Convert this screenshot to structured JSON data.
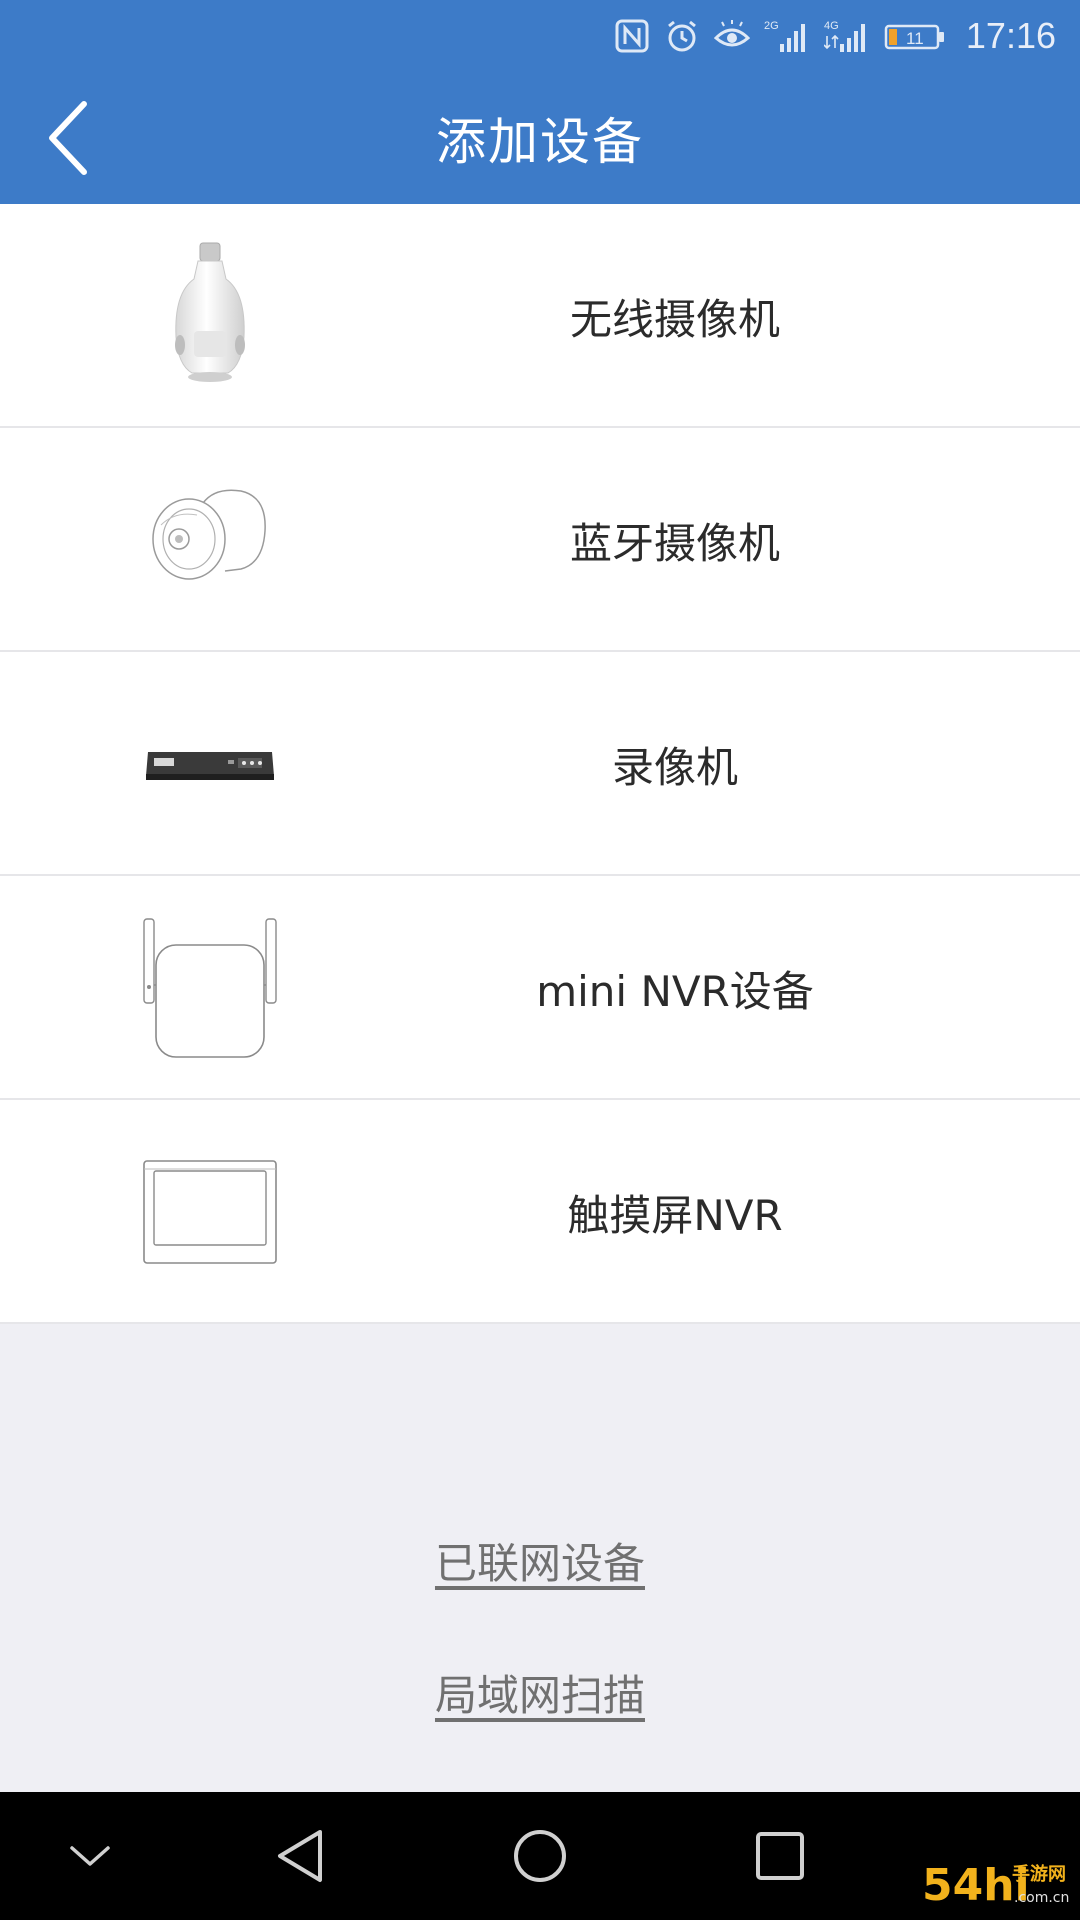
{
  "status_bar": {
    "icons": [
      "nfc-icon",
      "alarm-icon",
      "eye-comfort-icon",
      "signal-2g-icon",
      "signal-4g-icon",
      "battery-icon"
    ],
    "network_1": "2G",
    "network_2": "4G",
    "battery_level": "11",
    "time": "17:16"
  },
  "header": {
    "title": "添加设备",
    "back_icon": "chevron-left-icon"
  },
  "devices": [
    {
      "label": "无线摄像机",
      "icon": "bulb-camera-icon"
    },
    {
      "label": "蓝牙摄像机",
      "icon": "dome-camera-icon"
    },
    {
      "label": "录像机",
      "icon": "dvr-recorder-icon"
    },
    {
      "label": "mini NVR设备",
      "icon": "mini-nvr-router-icon"
    },
    {
      "label": "触摸屏NVR",
      "icon": "touchscreen-monitor-icon"
    }
  ],
  "links": {
    "networked_devices": "已联网设备",
    "lan_scan": "局域网扫描"
  },
  "nav_bar": {
    "icons": [
      "hide-nav-icon",
      "back-triangle-icon",
      "home-circle-icon",
      "recents-square-icon"
    ]
  },
  "colors": {
    "header_blue": "#3d7bc8",
    "background": "#efeff4",
    "link_gray": "#707070"
  },
  "watermark": {
    "brand": "54hi",
    "text": "手游网",
    "domain": ".com.cn"
  }
}
